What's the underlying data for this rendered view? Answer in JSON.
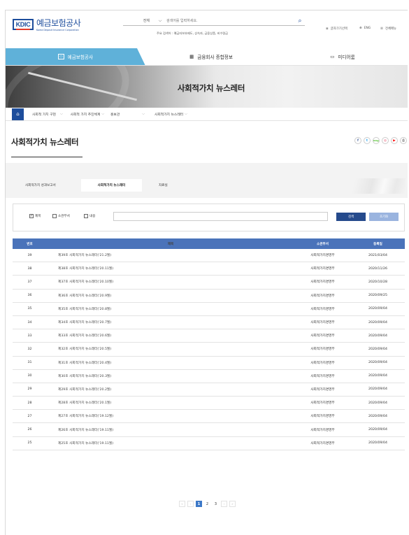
{
  "header": {
    "logo_mark": "KDIC",
    "logo_ko": "예금보험공사",
    "logo_en": "Korea Deposit Insurance Corporation",
    "search_scope": "전체",
    "search_placeholder": "검색어를 입력하세요.",
    "popular_keywords": "주요 검색어 : 예금자보호제도, 상속자, 금융상품, 비수령금",
    "util": [
      {
        "icon": "text-size-icon",
        "label": "글자크기선택"
      },
      {
        "icon": "globe-icon",
        "label": "ENG"
      },
      {
        "icon": "menu-icon",
        "label": "전체메뉴"
      }
    ]
  },
  "gnb": [
    {
      "icon": "kdic-icon",
      "label": "예금보험공사",
      "active": true
    },
    {
      "icon": "building-icon",
      "label": "금융회사 종합정보",
      "active": false
    },
    {
      "icon": "monitor-icon",
      "label": "미디어룸",
      "active": false
    }
  ],
  "hero": {
    "title": "사회적가치 뉴스레터"
  },
  "breadcrumb": [
    {
      "label": "사회적 가치 구현"
    },
    {
      "label": "사회적 가치 추진체계"
    },
    {
      "label": "홍보관"
    },
    {
      "label": "사회적가치 뉴스레터"
    }
  ],
  "page": {
    "title": "사회적가치 뉴스레터",
    "sns": [
      {
        "icon": "facebook-icon",
        "glyph": "f",
        "color": "#3b5998"
      },
      {
        "icon": "twitter-icon",
        "glyph": "t",
        "color": "#1da1f2"
      },
      {
        "icon": "blog-icon",
        "glyph": "blog",
        "color": "#2db400"
      },
      {
        "icon": "instagram-icon",
        "glyph": "◎",
        "color": "#e4405f"
      },
      {
        "icon": "youtube-icon",
        "glyph": "▶",
        "color": "#ff0000"
      },
      {
        "icon": "print-icon",
        "glyph": "⎙",
        "color": "#888888"
      }
    ]
  },
  "tabs": [
    {
      "label": "사회적가치 성과보고서",
      "active": false
    },
    {
      "label": "사회적가치 뉴스레터",
      "active": true
    },
    {
      "label": "자료실",
      "active": false
    }
  ],
  "filter": {
    "options": [
      {
        "label": "제목",
        "checked": true
      },
      {
        "label": "소관부서",
        "checked": false
      },
      {
        "label": "내용",
        "checked": false
      }
    ],
    "search_label": "검색",
    "reset_label": "초기화"
  },
  "table": {
    "headers": [
      "번호",
      "제목",
      "소관부서",
      "등록일"
    ],
    "rows": [
      [
        "39",
        "제39호 사회적가치 뉴스레터('21.2월)",
        "사회적가치경영부",
        "2021/03/04"
      ],
      [
        "38",
        "제38호 사회적가치 뉴스레터('20.11월)",
        "사회적가치경영부",
        "2020/11/26"
      ],
      [
        "37",
        "제37호 사회적가치 뉴스레터('20.10월)",
        "사회적가치경영부",
        "2020/10/28"
      ],
      [
        "36",
        "제36호 사회적가치 뉴스레터('20.9월)",
        "사회적가치경영부",
        "2020/09/25"
      ],
      [
        "35",
        "제35호 사회적가치 뉴스레터('20.8월)",
        "사회적가치경영부",
        "2020/09/04"
      ],
      [
        "34",
        "제34호 사회적가치 뉴스레터('20.7월)",
        "사회적가치경영부",
        "2020/09/04"
      ],
      [
        "33",
        "제33호 사회적가치 뉴스레터('20.6월)",
        "사회적가치경영부",
        "2020/09/04"
      ],
      [
        "32",
        "제32호 사회적가치 뉴스레터('20.5월)",
        "사회적가치경영부",
        "2020/09/04"
      ],
      [
        "31",
        "제31호 사회적가치 뉴스레터('20.4월)",
        "사회적가치경영부",
        "2020/09/04"
      ],
      [
        "30",
        "제30호 사회적가치 뉴스레터('20.3월)",
        "사회적가치경영부",
        "2020/09/04"
      ],
      [
        "29",
        "제29호 사회적가치 뉴스레터('20.2월)",
        "사회적가치경영부",
        "2020/09/04"
      ],
      [
        "28",
        "제28호 사회적가치 뉴스레터('20.1월)",
        "사회적가치경영부",
        "2020/09/04"
      ],
      [
        "27",
        "제27호 사회적가치 뉴스레터('19.12월)",
        "사회적가치경영부",
        "2020/09/04"
      ],
      [
        "26",
        "제26호 사회적가치 뉴스레터('19.11월)",
        "사회적가치경영부",
        "2020/09/04"
      ],
      [
        "25",
        "제25호 사회적가치 뉴스레터('19.11월)",
        "사회적가치경영부",
        "2020/09/04"
      ]
    ]
  },
  "pagination": {
    "first": "«",
    "prev": "‹",
    "pages": [
      "1",
      "2",
      "3"
    ],
    "current": "1",
    "next": "›",
    "last": "»"
  }
}
